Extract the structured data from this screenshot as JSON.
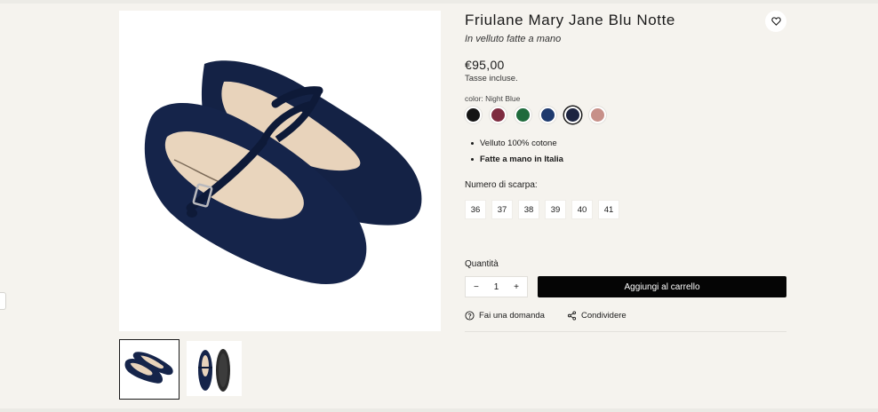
{
  "product": {
    "title": "Friulane Mary Jane Blu Notte",
    "subtitle": "In velluto fatte a mano",
    "price": "€95,00",
    "tax_note": "Tasse incluse.",
    "color_label": "color: Night Blue",
    "colors": [
      {
        "name": "Black",
        "hex": "#151515",
        "selected": false
      },
      {
        "name": "Bordeaux",
        "hex": "#7e2c40",
        "selected": false
      },
      {
        "name": "Green",
        "hex": "#1f6b3c",
        "selected": false
      },
      {
        "name": "Royal Blue",
        "hex": "#1e3a6e",
        "selected": false
      },
      {
        "name": "Night Blue",
        "hex": "#1c2440",
        "selected": true
      },
      {
        "name": "Pink",
        "hex": "#c79089",
        "selected": false
      }
    ],
    "features": [
      "Velluto 100% cotone",
      "Fatte a mano in Italia"
    ],
    "size_label": "Numero di scarpa:",
    "sizes": [
      "36",
      "37",
      "38",
      "39",
      "40",
      "41"
    ],
    "quantity_label": "Quantità",
    "quantity": "1",
    "minus": "−",
    "plus": "+",
    "add_to_cart": "Aggiungi al carrello",
    "ask_question": "Fai una domanda",
    "share": "Condividere"
  },
  "icons": {
    "favorite": "heart-icon",
    "question": "question-circle-icon",
    "share": "share-icon"
  }
}
